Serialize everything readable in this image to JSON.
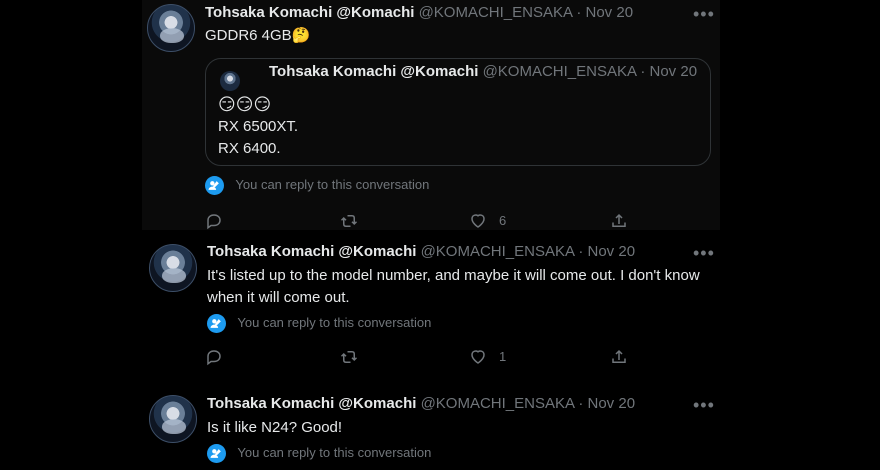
{
  "tweets": [
    {
      "name": "Tohsaka Komachi @Komachi",
      "handle_date": "@KOMACHI_ENSAKA · Nov 20",
      "text": "GDDR6 4GB🤔",
      "quote": {
        "name": "Tohsaka Komachi @Komachi",
        "handle_date": "@KOMACHI_ENSAKA · Nov 20",
        "emoji": "😏😏😏",
        "text": "RX 6500XT.\nRX 6400."
      },
      "notice": "You can reply to this conversation",
      "like_count": "6"
    },
    {
      "name": "Tohsaka Komachi @Komachi",
      "handle_date": "@KOMACHI_ENSAKA · Nov 20",
      "text": "It's listed up to the model number, and maybe it will come out. I don't know when it will come out.",
      "notice": "You can reply to this conversation",
      "like_count": "1"
    },
    {
      "name": "Tohsaka Komachi @Komachi",
      "handle_date": "@KOMACHI_ENSAKA · Nov 20",
      "text": "Is it like N24? Good!",
      "notice": "You can reply to this conversation"
    }
  ],
  "icons": {
    "more": "more-icon",
    "reply": "reply-icon",
    "retweet": "retweet-icon",
    "like": "heart-icon",
    "share": "share-icon",
    "notice": "people-icon"
  },
  "colors": {
    "background": "#000000",
    "text": "#e7e9ea",
    "secondary": "#71767b",
    "accent": "#1d9bf0",
    "border": "#2f3336"
  }
}
